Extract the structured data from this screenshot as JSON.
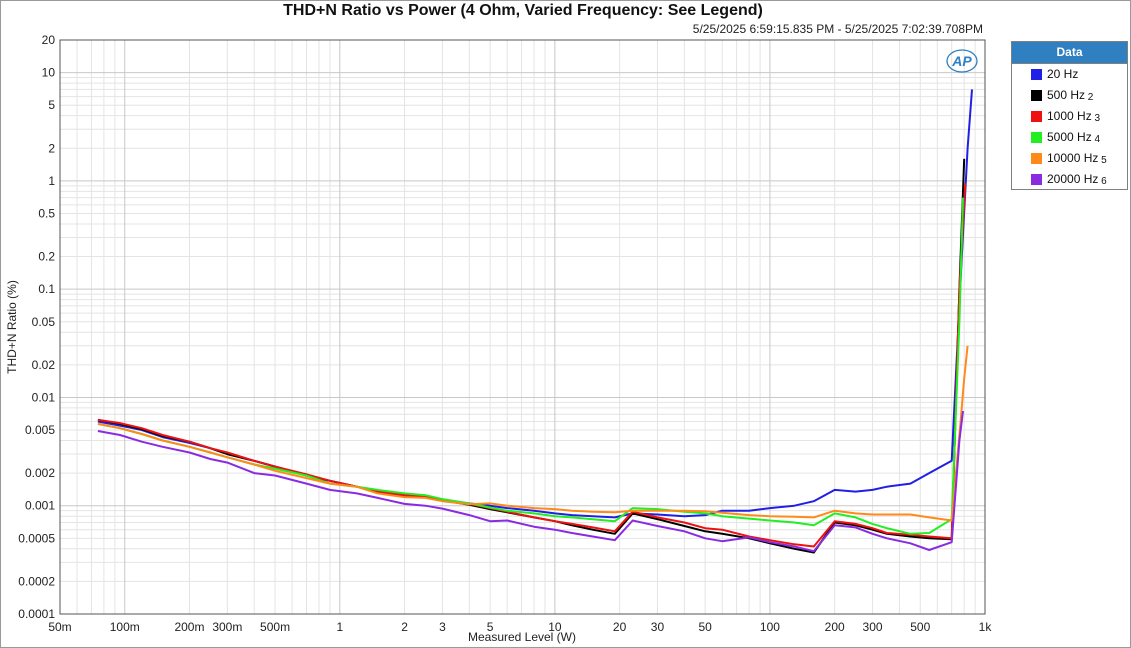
{
  "window": {
    "title": "THD+N Ratio vs Power (4 Ohm, Varied Frequency: See Legend)",
    "subtitle": "5/25/2025 6:59:15.835 PM - 5/25/2025 7:02:39.708PM",
    "logo": "AP"
  },
  "legend": {
    "header": "Data",
    "items": [
      {
        "label": "20 Hz",
        "suffix": "",
        "color": "#1f1fe6"
      },
      {
        "label": "500 Hz",
        "suffix": "2",
        "color": "#000000"
      },
      {
        "label": "1000 Hz",
        "suffix": "3",
        "color": "#ee1111"
      },
      {
        "label": "5000 Hz",
        "suffix": "4",
        "color": "#22ee22"
      },
      {
        "label": "10000 Hz",
        "suffix": "5",
        "color": "#ff8a1a"
      },
      {
        "label": "20000 Hz",
        "suffix": "6",
        "color": "#8a2be2"
      }
    ]
  },
  "chart_data": {
    "type": "line",
    "title": "THD+N Ratio vs Power (4 Ohm, Varied Frequency: See Legend)",
    "xlabel": "Measured Level (W)",
    "ylabel": "THD+N Ratio (%)",
    "x_scale": "log",
    "y_scale": "log",
    "xlim": [
      0.05,
      1000
    ],
    "ylim": [
      0.0001,
      20
    ],
    "grid": true,
    "legend_position": "right",
    "x_ticks": [
      {
        "value": 0.05,
        "label": "50m"
      },
      {
        "value": 0.1,
        "label": "100m"
      },
      {
        "value": 0.2,
        "label": "200m"
      },
      {
        "value": 0.3,
        "label": "300m"
      },
      {
        "value": 0.5,
        "label": "500m"
      },
      {
        "value": 1,
        "label": "1"
      },
      {
        "value": 2,
        "label": "2"
      },
      {
        "value": 3,
        "label": "3"
      },
      {
        "value": 5,
        "label": "5"
      },
      {
        "value": 10,
        "label": "10"
      },
      {
        "value": 20,
        "label": "20"
      },
      {
        "value": 30,
        "label": "30"
      },
      {
        "value": 50,
        "label": "50"
      },
      {
        "value": 100,
        "label": "100"
      },
      {
        "value": 200,
        "label": "200"
      },
      {
        "value": 300,
        "label": "300"
      },
      {
        "value": 500,
        "label": "500"
      },
      {
        "value": 1000,
        "label": "1k"
      }
    ],
    "y_ticks": [
      {
        "value": 20,
        "label": "20"
      },
      {
        "value": 10,
        "label": "10"
      },
      {
        "value": 5,
        "label": "5"
      },
      {
        "value": 2,
        "label": "2"
      },
      {
        "value": 1,
        "label": "1"
      },
      {
        "value": 0.5,
        "label": "0.5"
      },
      {
        "value": 0.2,
        "label": "0.2"
      },
      {
        "value": 0.1,
        "label": "0.1"
      },
      {
        "value": 0.05,
        "label": "0.05"
      },
      {
        "value": 0.02,
        "label": "0.02"
      },
      {
        "value": 0.01,
        "label": "0.01"
      },
      {
        "value": 0.005,
        "label": "0.005"
      },
      {
        "value": 0.002,
        "label": "0.002"
      },
      {
        "value": 0.001,
        "label": "0.001"
      },
      {
        "value": 0.0005,
        "label": "0.0005"
      },
      {
        "value": 0.0002,
        "label": "0.0002"
      },
      {
        "value": 0.0001,
        "label": "0.0001"
      }
    ],
    "series": [
      {
        "name": "20 Hz",
        "color": "#1f1fe6",
        "x": [
          0.075,
          0.095,
          0.12,
          0.15,
          0.2,
          0.25,
          0.3,
          0.4,
          0.5,
          0.7,
          0.9,
          1.2,
          1.5,
          2,
          2.5,
          3,
          4,
          5,
          6,
          8,
          10,
          12,
          15,
          19,
          23,
          30,
          40,
          50,
          60,
          80,
          100,
          130,
          160,
          200,
          250,
          300,
          350,
          450,
          550,
          700,
          780,
          830,
          870
        ],
        "y": [
          0.006,
          0.0055,
          0.005,
          0.0043,
          0.0038,
          0.0034,
          0.003,
          0.0026,
          0.0023,
          0.0019,
          0.0017,
          0.0015,
          0.00135,
          0.00125,
          0.0012,
          0.00112,
          0.00105,
          0.001,
          0.00095,
          0.0009,
          0.00085,
          0.00082,
          0.0008,
          0.00078,
          0.00085,
          0.00083,
          0.0008,
          0.00082,
          0.0009,
          0.0009,
          0.00095,
          0.001,
          0.0011,
          0.0014,
          0.00135,
          0.0014,
          0.0015,
          0.0016,
          0.002,
          0.0026,
          0.2,
          2.0,
          7.0
        ]
      },
      {
        "name": "500 Hz",
        "color": "#000000",
        "x": [
          0.075,
          0.095,
          0.12,
          0.15,
          0.2,
          0.25,
          0.3,
          0.4,
          0.5,
          0.7,
          0.9,
          1.2,
          1.5,
          2,
          2.5,
          3,
          4,
          5,
          6,
          8,
          10,
          12,
          15,
          19,
          23,
          30,
          40,
          50,
          60,
          80,
          100,
          130,
          160,
          200,
          250,
          300,
          350,
          450,
          550,
          700,
          760,
          800
        ],
        "y": [
          0.0062,
          0.0057,
          0.0051,
          0.0044,
          0.0039,
          0.0034,
          0.003,
          0.0026,
          0.0023,
          0.0019,
          0.0017,
          0.0015,
          0.00135,
          0.00125,
          0.0012,
          0.00112,
          0.00102,
          0.00093,
          0.00087,
          0.00078,
          0.00072,
          0.00066,
          0.0006,
          0.00055,
          0.00085,
          0.00075,
          0.00065,
          0.00058,
          0.00055,
          0.0005,
          0.00045,
          0.0004,
          0.00037,
          0.0007,
          0.00066,
          0.0006,
          0.00055,
          0.00052,
          0.0005,
          0.00049,
          0.1,
          1.6
        ]
      },
      {
        "name": "1000 Hz",
        "color": "#ee1111",
        "x": [
          0.075,
          0.095,
          0.12,
          0.15,
          0.2,
          0.25,
          0.3,
          0.4,
          0.5,
          0.7,
          0.9,
          1.2,
          1.5,
          2,
          2.5,
          3,
          4,
          5,
          6,
          8,
          10,
          12,
          15,
          19,
          23,
          30,
          40,
          50,
          60,
          80,
          100,
          130,
          160,
          200,
          250,
          300,
          350,
          450,
          550,
          700,
          760,
          810
        ],
        "y": [
          0.0062,
          0.0058,
          0.0052,
          0.0045,
          0.0039,
          0.0034,
          0.0031,
          0.0026,
          0.0023,
          0.00195,
          0.0017,
          0.0015,
          0.00135,
          0.00125,
          0.0012,
          0.00112,
          0.00104,
          0.00095,
          0.00088,
          0.00078,
          0.00072,
          0.00068,
          0.00063,
          0.00058,
          0.00088,
          0.00078,
          0.0007,
          0.00062,
          0.0006,
          0.00052,
          0.00048,
          0.00044,
          0.00042,
          0.00072,
          0.00068,
          0.00062,
          0.00056,
          0.00054,
          0.00052,
          0.0005,
          0.1,
          0.95
        ]
      },
      {
        "name": "5000 Hz",
        "color": "#22ee22",
        "x": [
          0.075,
          0.095,
          0.12,
          0.15,
          0.2,
          0.25,
          0.3,
          0.4,
          0.5,
          0.7,
          0.9,
          1.2,
          1.5,
          2,
          2.5,
          3,
          4,
          5,
          6,
          8,
          10,
          12,
          15,
          19,
          23,
          30,
          40,
          50,
          60,
          80,
          100,
          130,
          160,
          200,
          250,
          300,
          350,
          450,
          550,
          700,
          760,
          790
        ],
        "y": [
          0.0057,
          0.0052,
          0.0046,
          0.004,
          0.0035,
          0.0031,
          0.0028,
          0.0024,
          0.0022,
          0.0019,
          0.0016,
          0.0015,
          0.0014,
          0.0013,
          0.00125,
          0.00115,
          0.00105,
          0.00096,
          0.0009,
          0.00085,
          0.0008,
          0.00078,
          0.00075,
          0.00072,
          0.00095,
          0.00093,
          0.00088,
          0.00085,
          0.0008,
          0.00076,
          0.00073,
          0.0007,
          0.00066,
          0.00085,
          0.00078,
          0.00068,
          0.00062,
          0.00055,
          0.00056,
          0.00075,
          0.05,
          0.7
        ]
      },
      {
        "name": "10000 Hz",
        "color": "#ff8a1a",
        "x": [
          0.075,
          0.095,
          0.12,
          0.15,
          0.2,
          0.25,
          0.3,
          0.4,
          0.5,
          0.7,
          0.9,
          1.2,
          1.5,
          2,
          2.5,
          3,
          4,
          5,
          6,
          8,
          10,
          12,
          15,
          19,
          23,
          30,
          40,
          50,
          60,
          80,
          100,
          130,
          160,
          200,
          250,
          300,
          350,
          450,
          550,
          700,
          770,
          800,
          830
        ],
        "y": [
          0.0057,
          0.0052,
          0.0046,
          0.004,
          0.0035,
          0.0031,
          0.0028,
          0.0024,
          0.0021,
          0.0018,
          0.0016,
          0.0015,
          0.0013,
          0.0012,
          0.00118,
          0.0011,
          0.00103,
          0.00105,
          0.001,
          0.00095,
          0.00093,
          0.0009,
          0.00088,
          0.00087,
          0.0009,
          0.0009,
          0.0009,
          0.00089,
          0.00086,
          0.00082,
          0.0008,
          0.00079,
          0.00078,
          0.0009,
          0.00085,
          0.00083,
          0.00083,
          0.00083,
          0.00078,
          0.00073,
          0.006,
          0.015,
          0.03
        ]
      },
      {
        "name": "20000 Hz",
        "color": "#8a2be2",
        "x": [
          0.075,
          0.095,
          0.12,
          0.15,
          0.2,
          0.25,
          0.3,
          0.4,
          0.5,
          0.7,
          0.9,
          1.2,
          1.5,
          2,
          2.5,
          3,
          4,
          5,
          6,
          8,
          10,
          12,
          15,
          19,
          23,
          30,
          40,
          50,
          60,
          80,
          100,
          130,
          160,
          200,
          250,
          300,
          350,
          450,
          550,
          700,
          760,
          790
        ],
        "y": [
          0.0049,
          0.0045,
          0.0039,
          0.0035,
          0.0031,
          0.0027,
          0.0025,
          0.002,
          0.0019,
          0.0016,
          0.0014,
          0.0013,
          0.00118,
          0.00104,
          0.001,
          0.00094,
          0.00082,
          0.00072,
          0.00073,
          0.00064,
          0.0006,
          0.00056,
          0.00052,
          0.00048,
          0.00073,
          0.00065,
          0.00058,
          0.0005,
          0.00047,
          0.00051,
          0.00046,
          0.00042,
          0.00038,
          0.00066,
          0.00063,
          0.00055,
          0.0005,
          0.00045,
          0.00039,
          0.00046,
          0.004,
          0.0075
        ]
      }
    ]
  }
}
